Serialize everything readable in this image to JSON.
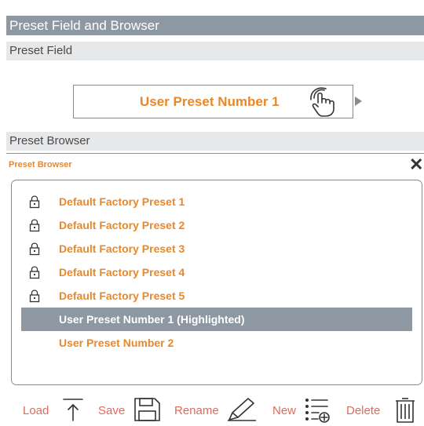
{
  "title_bar": {
    "label": "Preset Field and Browser"
  },
  "preset_field_section": {
    "label": "Preset Field"
  },
  "preset_field": {
    "value": "User Preset Number 1"
  },
  "preset_browser_section": {
    "label": "Preset Browser"
  },
  "browser_panel": {
    "title": "Preset Browser",
    "close_label": "✕",
    "items": [
      {
        "label": "Default Factory Preset 1",
        "locked": true,
        "highlighted": false
      },
      {
        "label": "Default Factory Preset 2",
        "locked": true,
        "highlighted": false
      },
      {
        "label": "Default Factory Preset 3",
        "locked": true,
        "highlighted": false
      },
      {
        "label": "Default Factory Preset 4",
        "locked": true,
        "highlighted": false
      },
      {
        "label": "Default Factory Preset 5",
        "locked": true,
        "highlighted": false
      },
      {
        "label": "User Preset Number 1 (Highlighted)",
        "locked": false,
        "highlighted": true
      },
      {
        "label": "User Preset Number 2",
        "locked": false,
        "highlighted": false
      }
    ]
  },
  "toolbar": {
    "load_label": "Load",
    "save_label": "Save",
    "rename_label": "Rename",
    "new_label": "New",
    "delete_label": "Delete"
  },
  "colors": {
    "accent_orange": "#e8882a",
    "toolbar_label": "#e06a5b",
    "header_gray": "#8e98a3",
    "section_gray": "#e7e8ea"
  },
  "icons": [
    "touch-hand-icon",
    "lock-icon",
    "close-icon",
    "load-arrow-icon",
    "save-floppy-icon",
    "rename-pencil-icon",
    "new-list-icon",
    "delete-trash-icon"
  ]
}
